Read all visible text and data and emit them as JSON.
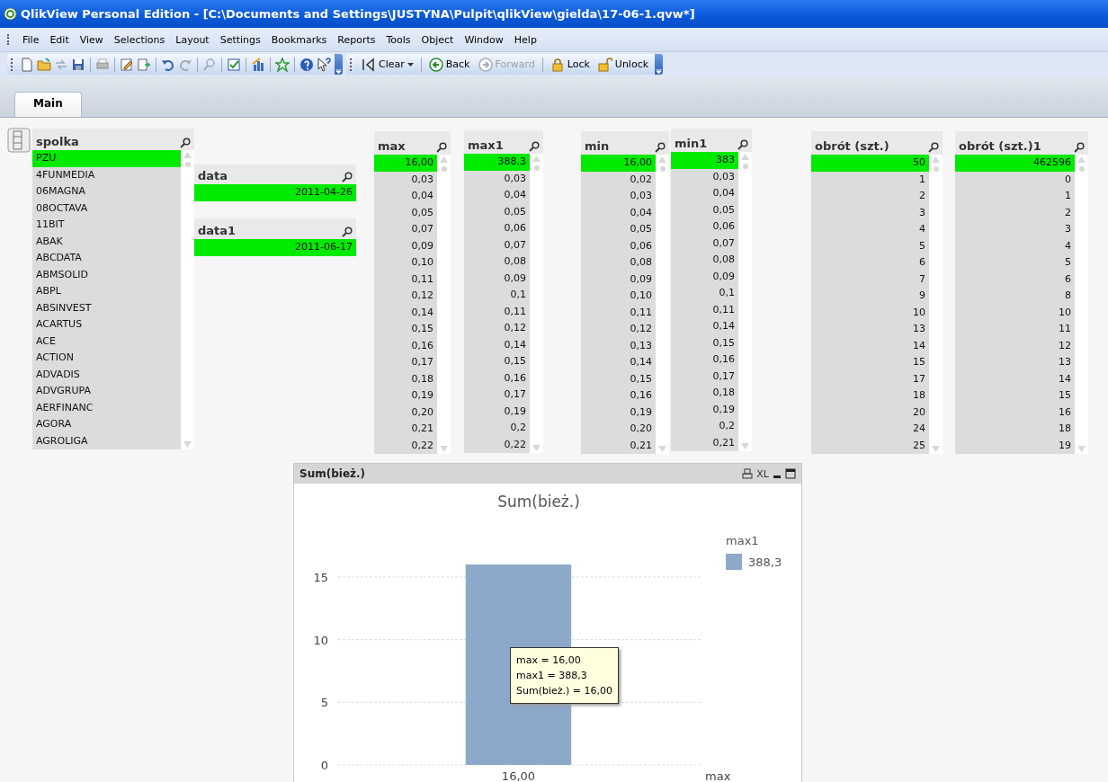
{
  "window": {
    "title": "QlikView Personal Edition - [C:\\Documents and Settings\\JUSTYNA\\Pulpit\\qlikView\\gielda\\17-06-1.qvw*]"
  },
  "menu": [
    "File",
    "Edit",
    "View",
    "Selections",
    "Layout",
    "Settings",
    "Bookmarks",
    "Reports",
    "Tools",
    "Object",
    "Window",
    "Help"
  ],
  "toolbar": {
    "buttons": [
      {
        "label": "Clear",
        "kind": "clear",
        "disabled": false
      },
      {
        "label": "Back",
        "kind": "back",
        "disabled": false
      },
      {
        "label": "Forward",
        "kind": "forward",
        "disabled": true
      },
      {
        "label": "Lock",
        "kind": "lock",
        "disabled": false
      },
      {
        "label": "Unlock",
        "kind": "unlock",
        "disabled": false
      }
    ]
  },
  "tabs": [
    {
      "label": "Main",
      "selected": true
    }
  ],
  "listboxes": [
    {
      "title": "spolka",
      "kind": "text",
      "values": [
        {
          "text": "PZU",
          "selected": true
        },
        {
          "text": "4FUNMEDIA",
          "selected": false
        },
        {
          "text": "06MAGNA",
          "selected": false
        },
        {
          "text": "08OCTAVA",
          "selected": false
        },
        {
          "text": "11BIT",
          "selected": false
        },
        {
          "text": "ABAK",
          "selected": false
        },
        {
          "text": "ABCDATA",
          "selected": false
        },
        {
          "text": "ABMSOLID",
          "selected": false
        },
        {
          "text": "ABPL",
          "selected": false
        },
        {
          "text": "ABSINVEST",
          "selected": false
        },
        {
          "text": "ACARTUS",
          "selected": false
        },
        {
          "text": "ACE",
          "selected": false
        },
        {
          "text": "ACTION",
          "selected": false
        },
        {
          "text": "ADVADIS",
          "selected": false
        },
        {
          "text": "ADVGRUPA",
          "selected": false
        },
        {
          "text": "AERFINANC",
          "selected": false
        },
        {
          "text": "AGORA",
          "selected": false
        },
        {
          "text": "AGROLIGA",
          "selected": false
        }
      ]
    },
    {
      "title": "data",
      "kind": "number",
      "values": [
        {
          "text": "2011-04-26",
          "selected": true
        }
      ]
    },
    {
      "title": "data1",
      "kind": "number",
      "values": [
        {
          "text": "2011-06-17",
          "selected": true
        }
      ]
    },
    {
      "title": "max",
      "kind": "number",
      "values": [
        {
          "text": "16,00",
          "selected": true
        },
        {
          "text": "0,03",
          "selected": false
        },
        {
          "text": "0,04",
          "selected": false
        },
        {
          "text": "0,05",
          "selected": false
        },
        {
          "text": "0,07",
          "selected": false
        },
        {
          "text": "0,09",
          "selected": false
        },
        {
          "text": "0,10",
          "selected": false
        },
        {
          "text": "0,11",
          "selected": false
        },
        {
          "text": "0,12",
          "selected": false
        },
        {
          "text": "0,14",
          "selected": false
        },
        {
          "text": "0,15",
          "selected": false
        },
        {
          "text": "0,16",
          "selected": false
        },
        {
          "text": "0,17",
          "selected": false
        },
        {
          "text": "0,18",
          "selected": false
        },
        {
          "text": "0,19",
          "selected": false
        },
        {
          "text": "0,20",
          "selected": false
        },
        {
          "text": "0,21",
          "selected": false
        },
        {
          "text": "0,22",
          "selected": false
        }
      ]
    },
    {
      "title": "max1",
      "kind": "number",
      "values": [
        {
          "text": "388,3",
          "selected": true
        },
        {
          "text": "0,03",
          "selected": false
        },
        {
          "text": "0,04",
          "selected": false
        },
        {
          "text": "0,05",
          "selected": false
        },
        {
          "text": "0,06",
          "selected": false
        },
        {
          "text": "0,07",
          "selected": false
        },
        {
          "text": "0,08",
          "selected": false
        },
        {
          "text": "0,09",
          "selected": false
        },
        {
          "text": "0,1",
          "selected": false
        },
        {
          "text": "0,11",
          "selected": false
        },
        {
          "text": "0,12",
          "selected": false
        },
        {
          "text": "0,14",
          "selected": false
        },
        {
          "text": "0,15",
          "selected": false
        },
        {
          "text": "0,16",
          "selected": false
        },
        {
          "text": "0,17",
          "selected": false
        },
        {
          "text": "0,19",
          "selected": false
        },
        {
          "text": "0,2",
          "selected": false
        },
        {
          "text": "0,22",
          "selected": false
        }
      ]
    },
    {
      "title": "min",
      "kind": "number",
      "values": [
        {
          "text": "16,00",
          "selected": true
        },
        {
          "text": "0,02",
          "selected": false
        },
        {
          "text": "0,03",
          "selected": false
        },
        {
          "text": "0,04",
          "selected": false
        },
        {
          "text": "0,05",
          "selected": false
        },
        {
          "text": "0,06",
          "selected": false
        },
        {
          "text": "0,08",
          "selected": false
        },
        {
          "text": "0,09",
          "selected": false
        },
        {
          "text": "0,10",
          "selected": false
        },
        {
          "text": "0,11",
          "selected": false
        },
        {
          "text": "0,12",
          "selected": false
        },
        {
          "text": "0,13",
          "selected": false
        },
        {
          "text": "0,14",
          "selected": false
        },
        {
          "text": "0,15",
          "selected": false
        },
        {
          "text": "0,16",
          "selected": false
        },
        {
          "text": "0,19",
          "selected": false
        },
        {
          "text": "0,20",
          "selected": false
        },
        {
          "text": "0,21",
          "selected": false
        }
      ]
    },
    {
      "title": "min1",
      "kind": "number",
      "values": [
        {
          "text": "383",
          "selected": true
        },
        {
          "text": "0,03",
          "selected": false
        },
        {
          "text": "0,04",
          "selected": false
        },
        {
          "text": "0,05",
          "selected": false
        },
        {
          "text": "0,06",
          "selected": false
        },
        {
          "text": "0,07",
          "selected": false
        },
        {
          "text": "0,08",
          "selected": false
        },
        {
          "text": "0,09",
          "selected": false
        },
        {
          "text": "0,1",
          "selected": false
        },
        {
          "text": "0,11",
          "selected": false
        },
        {
          "text": "0,14",
          "selected": false
        },
        {
          "text": "0,15",
          "selected": false
        },
        {
          "text": "0,16",
          "selected": false
        },
        {
          "text": "0,17",
          "selected": false
        },
        {
          "text": "0,18",
          "selected": false
        },
        {
          "text": "0,19",
          "selected": false
        },
        {
          "text": "0,2",
          "selected": false
        },
        {
          "text": "0,21",
          "selected": false
        }
      ]
    },
    {
      "title": "obrót (szt.)",
      "kind": "number",
      "values": [
        {
          "text": "50",
          "selected": true
        },
        {
          "text": "1",
          "selected": false
        },
        {
          "text": "2",
          "selected": false
        },
        {
          "text": "3",
          "selected": false
        },
        {
          "text": "4",
          "selected": false
        },
        {
          "text": "5",
          "selected": false
        },
        {
          "text": "6",
          "selected": false
        },
        {
          "text": "7",
          "selected": false
        },
        {
          "text": "9",
          "selected": false
        },
        {
          "text": "10",
          "selected": false
        },
        {
          "text": "13",
          "selected": false
        },
        {
          "text": "14",
          "selected": false
        },
        {
          "text": "15",
          "selected": false
        },
        {
          "text": "17",
          "selected": false
        },
        {
          "text": "18",
          "selected": false
        },
        {
          "text": "20",
          "selected": false
        },
        {
          "text": "24",
          "selected": false
        },
        {
          "text": "25",
          "selected": false
        }
      ]
    },
    {
      "title": "obrót (szt.)1",
      "kind": "number",
      "values": [
        {
          "text": "462596",
          "selected": true
        },
        {
          "text": "0",
          "selected": false
        },
        {
          "text": "1",
          "selected": false
        },
        {
          "text": "2",
          "selected": false
        },
        {
          "text": "3",
          "selected": false
        },
        {
          "text": "4",
          "selected": false
        },
        {
          "text": "5",
          "selected": false
        },
        {
          "text": "6",
          "selected": false
        },
        {
          "text": "8",
          "selected": false
        },
        {
          "text": "10",
          "selected": false
        },
        {
          "text": "11",
          "selected": false
        },
        {
          "text": "12",
          "selected": false
        },
        {
          "text": "13",
          "selected": false
        },
        {
          "text": "14",
          "selected": false
        },
        {
          "text": "15",
          "selected": false
        },
        {
          "text": "16",
          "selected": false
        },
        {
          "text": "18",
          "selected": false
        },
        {
          "text": "19",
          "selected": false
        }
      ]
    }
  ],
  "chart": {
    "caption": "Sum(bież.)",
    "caption_buttons": [
      "XL"
    ],
    "legend_title": "max1",
    "chart_data": {
      "type": "bar",
      "title": "Sum(bież.)",
      "xlabel": "max",
      "categories": [
        "16,00"
      ],
      "series": [
        {
          "name": "388,3",
          "color": "#8da9c9",
          "values": [
            16
          ]
        }
      ],
      "ylim": [
        0,
        16
      ],
      "yticks": [
        0,
        5,
        10,
        15
      ],
      "grid": true
    },
    "tooltip": [
      "max = 16,00",
      "max1 = 388,3",
      "Sum(bież.) = 16,00"
    ]
  }
}
